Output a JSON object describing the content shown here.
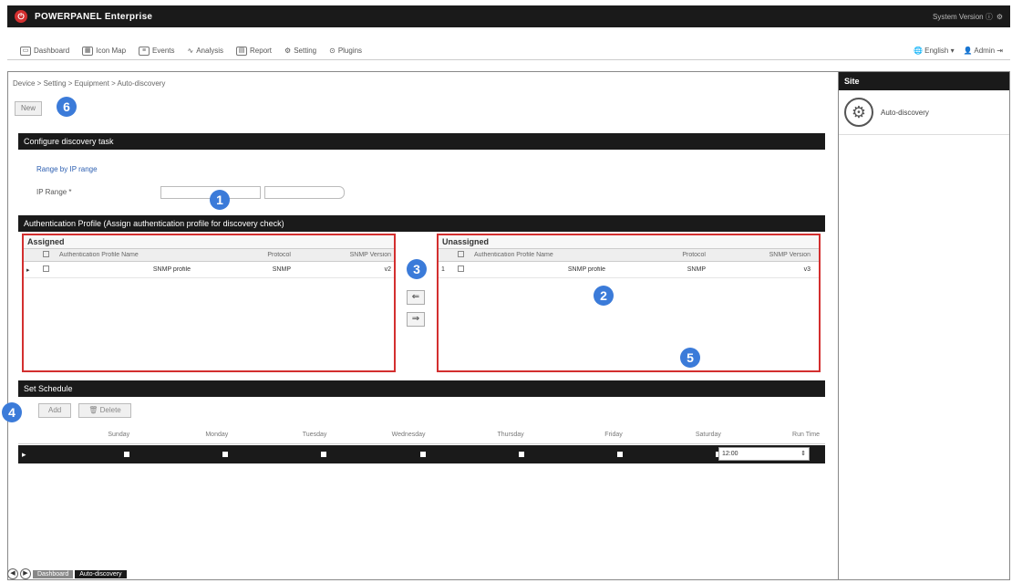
{
  "app": {
    "title": "POWERPANEL Enterprise",
    "system_info": "System Version ⓘ"
  },
  "menu": {
    "items": [
      {
        "label": "Dashboard",
        "icon": "dashboard-icon"
      },
      {
        "label": "Icon Map",
        "icon": "map-icon"
      },
      {
        "label": "Events",
        "icon": "events-icon"
      },
      {
        "label": "Analysis",
        "icon": "analysis-icon"
      },
      {
        "label": "Report",
        "icon": "report-icon"
      },
      {
        "label": "Setting",
        "icon": "gear-icon"
      },
      {
        "label": "Plugins",
        "icon": "plugin-icon"
      }
    ],
    "language": "English ▾",
    "user": "Admin"
  },
  "breadcrumb": "Device > Setting > Equipment > Auto-discovery",
  "new_button": "New",
  "config_section": {
    "title": "Configure discovery task",
    "range_label": "Range by IP range",
    "ip_label": "IP Range *"
  },
  "auth_section": {
    "title": "Authentication Profile (Assign authentication profile for discovery check)"
  },
  "assigned": {
    "title": "Assigned",
    "columns": [
      "Authentication Profile Name",
      "Protocol",
      "SNMP Version"
    ],
    "rows": [
      {
        "name": "SNMP profile",
        "protocol": "SNMP",
        "version": "v2"
      }
    ]
  },
  "unassigned": {
    "title": "Unassigned",
    "columns": [
      "Authentication Profile Name",
      "Protocol",
      "SNMP Version"
    ],
    "rows": [
      {
        "index": "1",
        "name": "SNMP profile",
        "protocol": "SNMP",
        "version": "v3"
      }
    ]
  },
  "arrows": {
    "left": "⇐",
    "right": "⇒"
  },
  "schedule": {
    "title": "Set Schedule",
    "add": "Add",
    "delete": "Delete",
    "columns": [
      "Sunday",
      "Monday",
      "Tuesday",
      "Wednesday",
      "Thursday",
      "Friday",
      "Saturday",
      "Run Time"
    ],
    "time_value": "12:00"
  },
  "right_panel": {
    "title": "Site",
    "item_label": "Auto-discovery"
  },
  "bottom_tabs": [
    "Dashboard",
    "Auto-discovery"
  ],
  "callouts": [
    "1",
    "2",
    "3",
    "4",
    "5",
    "6"
  ]
}
